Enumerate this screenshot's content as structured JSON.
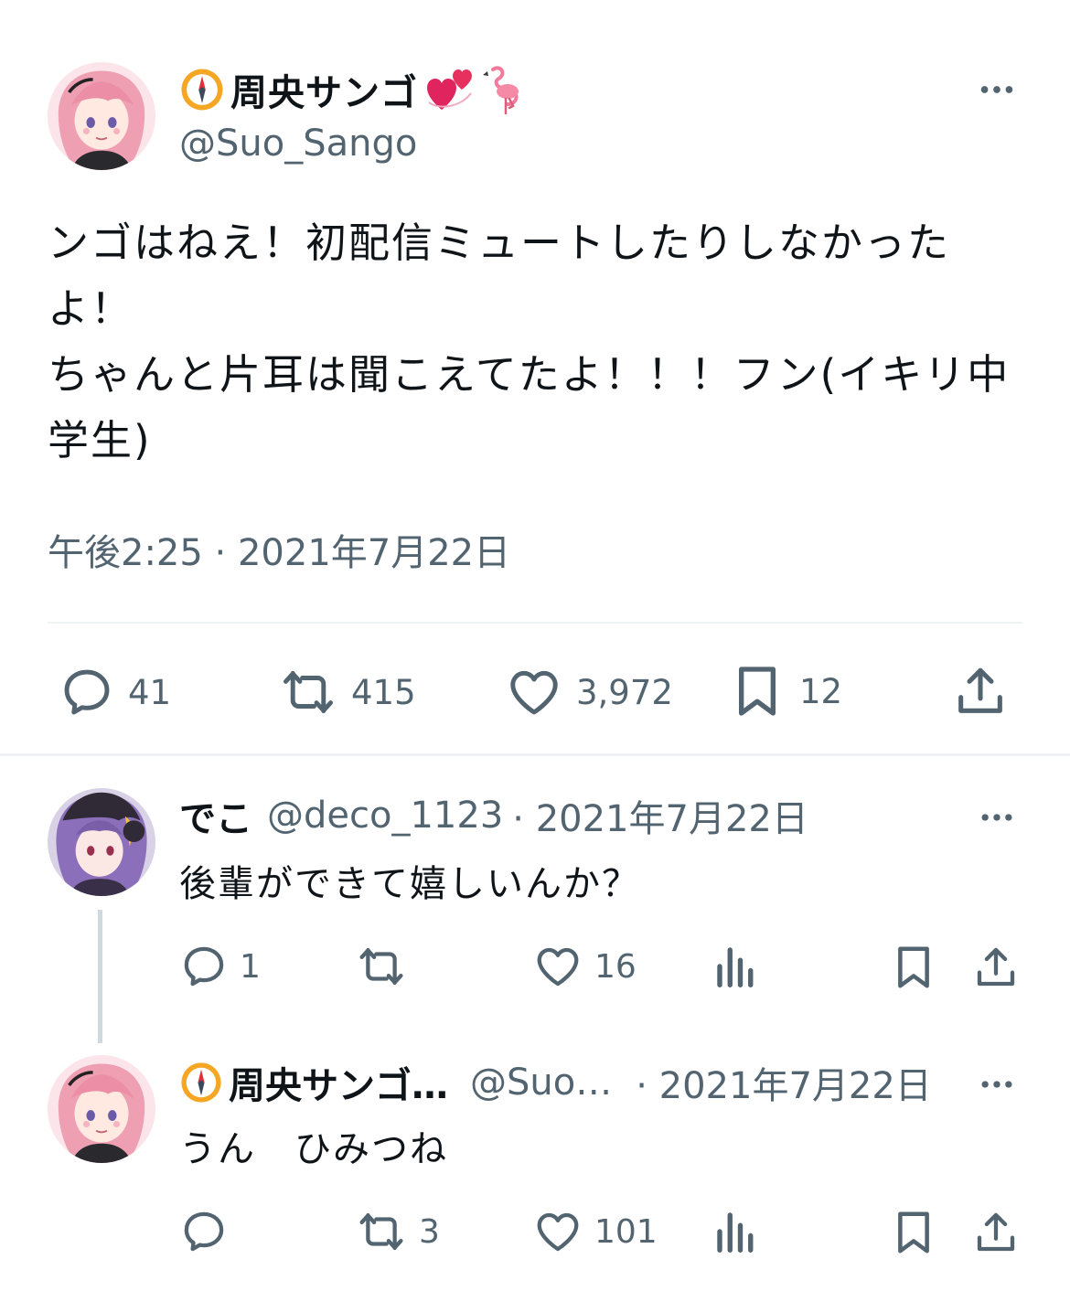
{
  "main_tweet": {
    "display_name": "周央サンゴ",
    "handle": "@Suo_Sango",
    "text_lines": [
      "ンゴはねえ！初配信ミュートしたりしなかった",
      "よ！",
      "ちゃんと片耳は聞こえてたよ！！！フン(イキリ中",
      "学生)"
    ],
    "timestamp": "午後2:25 · 2021年7月22日",
    "stats": {
      "replies": "41",
      "retweets": "415",
      "likes": "3,972",
      "bookmarks": "12"
    }
  },
  "replies": [
    {
      "display_name": "でこ",
      "handle": "@deco_1123",
      "date": "· 2021年7月22日",
      "text": "後輩ができて嬉しいんか？",
      "stats": {
        "replies": "1",
        "retweets": "",
        "likes": "16"
      }
    },
    {
      "display_name": "周央サンゴ…",
      "handle": "@Suo…",
      "date": "· 2021年7月22日",
      "text": "うん　ひみつね",
      "stats": {
        "replies": "",
        "retweets": "3",
        "likes": "101"
      }
    }
  ],
  "colors": {
    "text": "#0f1419",
    "secondary": "#536471",
    "divider": "#eff3f4",
    "thread_line": "#cfd9de",
    "avatar_pink": "#f2a9b8",
    "avatar_purple": "#8a6fb8"
  },
  "icons": [
    "compass-emoji-icon",
    "two-hearts-emoji-icon",
    "flamingo-emoji-icon",
    "more-icon",
    "reply-icon",
    "retweet-icon",
    "like-icon",
    "bookmark-icon",
    "share-icon",
    "views-icon"
  ]
}
